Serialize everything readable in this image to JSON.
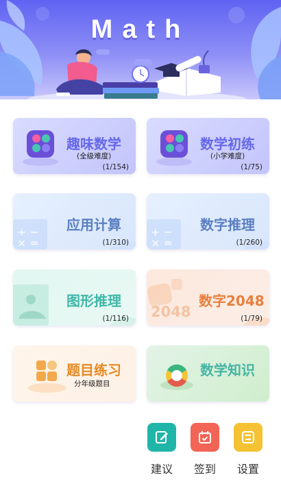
{
  "banner": {
    "title": "Math"
  },
  "cards": [
    {
      "title": "趣味数学",
      "subtitle": "(全级难度)",
      "count": "(1/154)"
    },
    {
      "title": "数学初练",
      "subtitle": "(小学难度)",
      "count": "(1/75)"
    },
    {
      "title": "应用计算",
      "count": "(1/310)"
    },
    {
      "title": "数字推理",
      "count": "(1/260)"
    },
    {
      "title": "图形推理",
      "count": "(1/116)"
    },
    {
      "title": "数字2048",
      "count": "(1/79)",
      "watermark": "2048"
    },
    {
      "title": "题目练习",
      "subtitle": "分年级题目"
    },
    {
      "title": "数学知识"
    }
  ],
  "toolbar": [
    {
      "label": "建议",
      "icon": "edit-icon",
      "color": "#1fb5a9"
    },
    {
      "label": "签到",
      "icon": "calendar-icon",
      "color": "#f26455"
    },
    {
      "label": "设置",
      "icon": "settings-list-icon",
      "color": "#f4c233"
    }
  ]
}
